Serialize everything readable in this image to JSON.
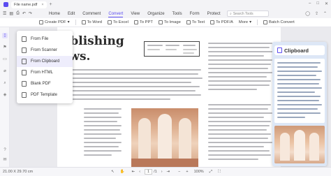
{
  "window": {
    "tab_title": "File name.pdf",
    "close_glyph": "×",
    "add_glyph": "+"
  },
  "menu": {
    "items": [
      "Home",
      "Edit",
      "Comment",
      "Convert",
      "View",
      "Organize",
      "Tools",
      "Form",
      "Protect"
    ],
    "active": "Convert",
    "search_placeholder": "Search Tools"
  },
  "toolbar": {
    "create_pdf": "Create PDF",
    "to_word": "To Word",
    "to_excel": "To Excel",
    "to_ppt": "To PPT",
    "to_image": "To Image",
    "to_text": "To Text",
    "to_pdfa": "To PDF/A",
    "more": "More",
    "batch_convert": "Batch Convert"
  },
  "dropdown": {
    "items": [
      "From File",
      "From Scanner",
      "From Clipboard",
      "From HTML",
      "Blank PDF",
      "PDF Template"
    ],
    "highlighted": "From Clipboard"
  },
  "document": {
    "heading_line1": "ublishing",
    "heading_line2": "ows."
  },
  "clipboard_panel": {
    "title": "Clipboard"
  },
  "status": {
    "dimensions": "21.00 X 29.70 cm",
    "page_current": "1",
    "page_total": "/1",
    "zoom": "100%"
  },
  "colors": {
    "accent": "#5b4cf0",
    "clipboard_bg": "#dde7f6",
    "dropdown_hover": "#eeedfc"
  }
}
